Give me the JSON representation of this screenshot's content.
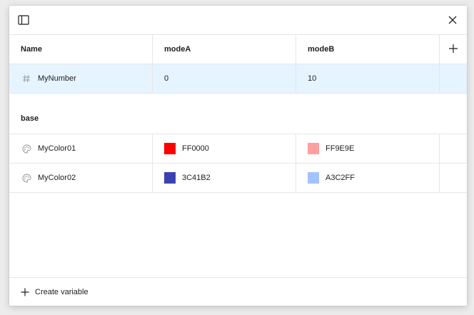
{
  "dialog": {
    "sidebar_icon": "sidebar-toggle-icon",
    "close_icon": "close-icon"
  },
  "table": {
    "columns": {
      "name": "Name",
      "modeA": "modeA",
      "modeB": "modeB"
    },
    "add_icon": "plus-icon",
    "rows": [
      {
        "icon": "number-hash-icon",
        "name": "MyNumber",
        "modeA": "0",
        "modeB": "10"
      }
    ],
    "groups": [
      {
        "title": "base",
        "rows": [
          {
            "icon": "color-palette-icon",
            "name": "MyColor01",
            "modeA": "FF0000",
            "modeA_color": "#FF0000",
            "modeB": "FF9E9E",
            "modeB_color": "#FF9E9E"
          },
          {
            "icon": "color-palette-icon",
            "name": "MyColor02",
            "modeA": "3C41B2",
            "modeA_color": "#3C41B2",
            "modeB": "A3C2FF",
            "modeB_color": "#A3C2FF"
          }
        ]
      }
    ]
  },
  "footer": {
    "create_label": "Create variable",
    "create_icon": "plus-icon"
  },
  "colors": {
    "selected_row": "#E5F4FF",
    "border": "#E6E6E6"
  }
}
